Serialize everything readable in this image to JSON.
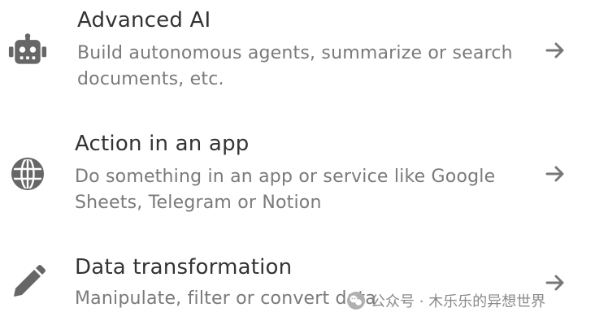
{
  "items": [
    {
      "icon": "robot-icon",
      "title": "Advanced AI",
      "description": "Build autonomous agents, summarize or search documents, etc.",
      "arrow": "arrow-right-icon"
    },
    {
      "icon": "globe-icon",
      "title": "Action in an app",
      "description": "Do something in an app or service like Google Sheets, Telegram or Notion",
      "arrow": "arrow-right-icon"
    },
    {
      "icon": "pencil-icon",
      "title": "Data transformation",
      "description": "Manipulate, filter or convert data",
      "arrow": "arrow-right-icon"
    }
  ],
  "watermark": {
    "text": "公众号 · 木乐乐的异想世界"
  },
  "colors": {
    "title": "#333333",
    "description": "#7a7a7a",
    "icon": "#666666",
    "arrow": "#777777"
  }
}
